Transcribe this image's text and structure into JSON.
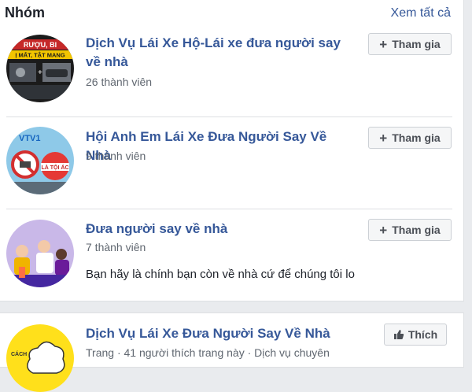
{
  "groups_section": {
    "title": "Nhóm",
    "see_all": "Xem tất cả",
    "items": [
      {
        "name": "Dịch Vụ Lái Xe Hộ-Lái xe đưa người say về nhà",
        "members": "26 thành viên",
        "join_label": "Tham gia",
        "avatar_text_1": "RƯỢU, BI",
        "avatar_text_2": "Ị MẤT, TẬT MANG"
      },
      {
        "name": "Hội Anh Em Lái Xe Đưa Người Say Về Nhà",
        "members": "9 thành viên",
        "join_label": "Tham gia",
        "avatar_text_1": "VTV1",
        "avatar_text_2": "LÀ TỘI ÁC"
      },
      {
        "name": "Đưa người say về nhà",
        "members": "7 thành viên",
        "description": "Bạn hãy là chính bạn còn về nhà cứ để chúng tôi lo",
        "join_label": "Tham gia"
      }
    ]
  },
  "page_result": {
    "name": "Dịch Vụ Lái Xe Đưa Người Say Về Nhà",
    "meta": "Trang · 41 người thích trang này · Dịch vụ chuyên",
    "like_label": "Thích",
    "avatar_text": "CÁCH"
  },
  "icons": {
    "join": "plus-icon",
    "like": "thumbs-up-icon"
  },
  "colors": {
    "link_blue": "#365899",
    "background": "#e9ebee",
    "button_bg": "#f5f6f7"
  }
}
